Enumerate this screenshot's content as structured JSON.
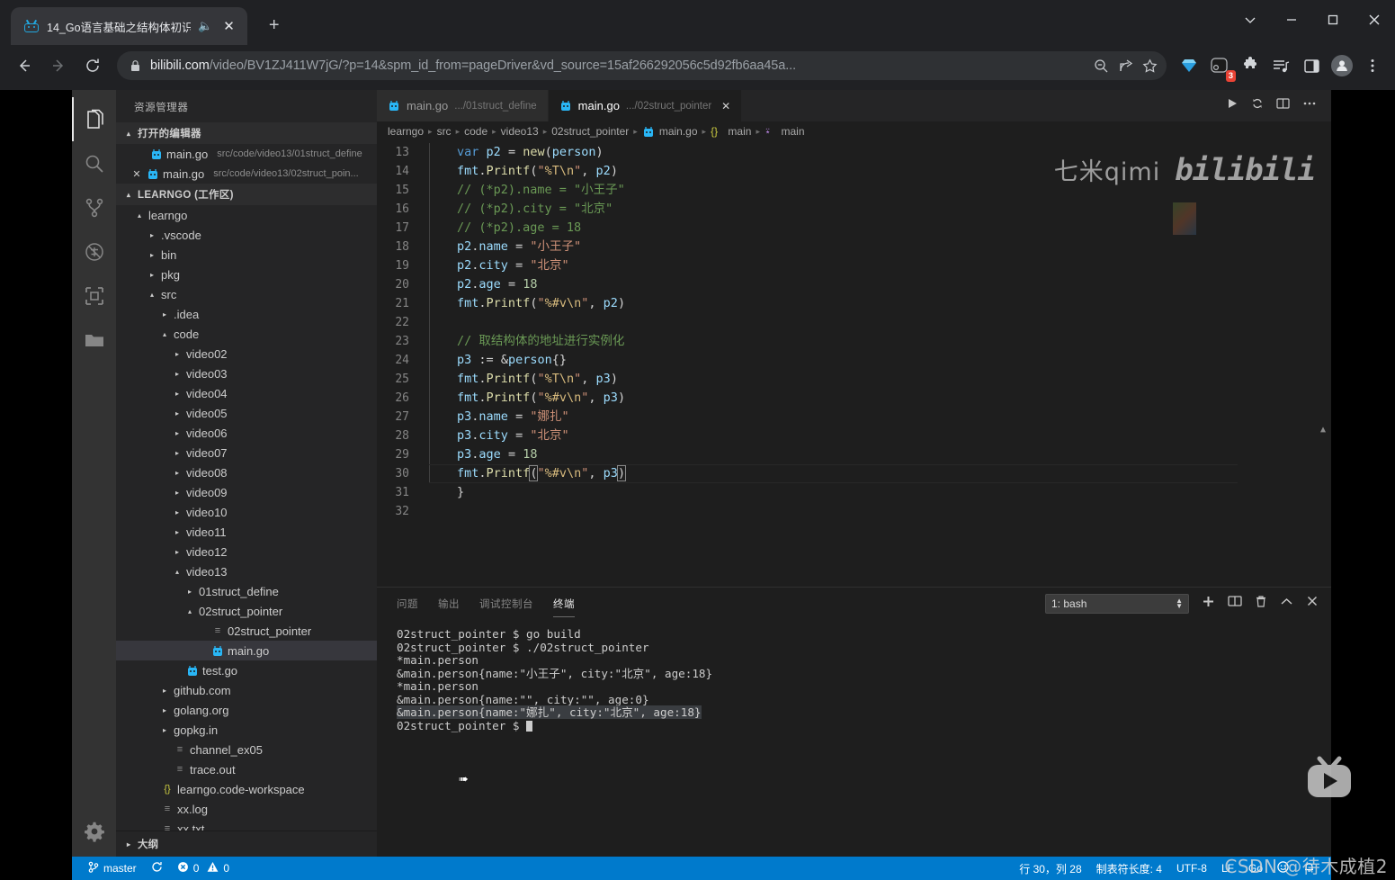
{
  "browser": {
    "tab": {
      "title": "14_Go语言基础之结构体初识",
      "favicon": "bilibili-tv-icon",
      "mute_icon": "speaker-mute-icon",
      "close_icon": "close-icon"
    },
    "newtab_label": "+",
    "window_controls": {
      "minimize_chevron": "chevron-down-icon",
      "minimize": "minimize-icon",
      "maximize": "maximize-icon",
      "close": "close-icon"
    },
    "nav": {
      "back": "back-arrow-icon",
      "forward": "forward-arrow-icon",
      "reload": "reload-icon"
    },
    "url": {
      "lock_icon": "lock-icon",
      "domain": "bilibili.com",
      "path": "/video/BV1ZJ411W7jG/?p=14&spm_id_from=pageDriver&vd_source=15af266292056c5d92fb6aa45a...",
      "zoom_icon": "zoom-out-icon",
      "share_icon": "share-icon",
      "bookmark_icon": "star-icon"
    },
    "toolbar_icons": [
      "diamond-extension-icon",
      "dark-reader-icon",
      "puzzle-extensions-icon",
      "playlist-icon",
      "side-panel-icon",
      "profile-avatar-icon",
      "chrome-menu-icon"
    ],
    "extension_badge": "3"
  },
  "vscode": {
    "activitybar": [
      {
        "name": "explorer-icon",
        "label": "资源管理器",
        "active": true
      },
      {
        "name": "search-icon",
        "label": "搜索",
        "active": false
      },
      {
        "name": "source-control-icon",
        "label": "源代码管理",
        "active": false
      },
      {
        "name": "run-debug-icon",
        "label": "运行和调试",
        "active": false
      },
      {
        "name": "extensions-icon",
        "label": "扩展",
        "active": false
      },
      {
        "name": "remote-folder-icon",
        "label": "远程资源管理器",
        "active": false
      },
      {
        "name": "settings-gear-icon",
        "label": "管理",
        "active": false
      }
    ],
    "sidebar": {
      "title": "资源管理器",
      "open_editors": {
        "label": "打开的编辑器",
        "twisty": "▴",
        "items": [
          {
            "name": "main.go",
            "path": "src/code/video13/01struct_define",
            "closable": false,
            "selected": false
          },
          {
            "name": "main.go",
            "path": "src/code/video13/02struct_poin...",
            "closable": true,
            "selected": false
          }
        ]
      },
      "workspace": {
        "label": "LEARNGO (工作区)",
        "twisty": "▴",
        "tree": [
          {
            "label": "learngo",
            "depth": 1,
            "type": "folder",
            "twisty": "▴"
          },
          {
            "label": ".vscode",
            "depth": 2,
            "type": "folder",
            "twisty": "▸"
          },
          {
            "label": "bin",
            "depth": 2,
            "type": "folder",
            "twisty": "▸"
          },
          {
            "label": "pkg",
            "depth": 2,
            "type": "folder",
            "twisty": "▸"
          },
          {
            "label": "src",
            "depth": 2,
            "type": "folder",
            "twisty": "▴"
          },
          {
            "label": ".idea",
            "depth": 3,
            "type": "folder",
            "twisty": "▸"
          },
          {
            "label": "code",
            "depth": 3,
            "type": "folder",
            "twisty": "▴"
          },
          {
            "label": "video02",
            "depth": 4,
            "type": "folder",
            "twisty": "▸"
          },
          {
            "label": "video03",
            "depth": 4,
            "type": "folder",
            "twisty": "▸"
          },
          {
            "label": "video04",
            "depth": 4,
            "type": "folder",
            "twisty": "▸"
          },
          {
            "label": "video05",
            "depth": 4,
            "type": "folder",
            "twisty": "▸"
          },
          {
            "label": "video06",
            "depth": 4,
            "type": "folder",
            "twisty": "▸"
          },
          {
            "label": "video07",
            "depth": 4,
            "type": "folder",
            "twisty": "▸"
          },
          {
            "label": "video08",
            "depth": 4,
            "type": "folder",
            "twisty": "▸"
          },
          {
            "label": "video09",
            "depth": 4,
            "type": "folder",
            "twisty": "▸"
          },
          {
            "label": "video10",
            "depth": 4,
            "type": "folder",
            "twisty": "▸"
          },
          {
            "label": "video11",
            "depth": 4,
            "type": "folder",
            "twisty": "▸"
          },
          {
            "label": "video12",
            "depth": 4,
            "type": "folder",
            "twisty": "▸"
          },
          {
            "label": "video13",
            "depth": 4,
            "type": "folder",
            "twisty": "▴"
          },
          {
            "label": "01struct_define",
            "depth": 5,
            "type": "folder",
            "twisty": "▸"
          },
          {
            "label": "02struct_pointer",
            "depth": 5,
            "type": "folder",
            "twisty": "▴"
          },
          {
            "label": "02struct_pointer",
            "depth": 6,
            "type": "binary"
          },
          {
            "label": "main.go",
            "depth": 6,
            "type": "go",
            "selected": true
          },
          {
            "label": "test.go",
            "depth": 4,
            "type": "go"
          },
          {
            "label": "github.com",
            "depth": 3,
            "type": "folder",
            "twisty": "▸"
          },
          {
            "label": "golang.org",
            "depth": 3,
            "type": "folder",
            "twisty": "▸"
          },
          {
            "label": "gopkg.in",
            "depth": 3,
            "type": "folder",
            "twisty": "▸"
          },
          {
            "label": "channel_ex05",
            "depth": 3,
            "type": "file"
          },
          {
            "label": "trace.out",
            "depth": 3,
            "type": "file"
          },
          {
            "label": "learngo.code-workspace",
            "depth": 2,
            "type": "json"
          },
          {
            "label": "xx.log",
            "depth": 2,
            "type": "file"
          },
          {
            "label": "xx.txt",
            "depth": 2,
            "type": "file"
          }
        ]
      },
      "outline_label": "大纲",
      "outline_twisty": "▸"
    },
    "editor_tabs": [
      {
        "name": "main.go",
        "path": ".../01struct_define",
        "active": false,
        "closable": false
      },
      {
        "name": "main.go",
        "path": ".../02struct_pointer",
        "active": true,
        "closable": true
      }
    ],
    "editor_actions": [
      "run-icon",
      "run-test-icon",
      "split-editor-icon",
      "more-actions-icon"
    ],
    "breadcrumb": [
      "learngo",
      "src",
      "code",
      "video13",
      "02struct_pointer",
      "main.go",
      "{} main",
      "main"
    ],
    "code_lines": [
      {
        "n": 13,
        "indent": true
      },
      {
        "n": 14,
        "indent": true
      },
      {
        "n": 15,
        "indent": true
      },
      {
        "n": 16,
        "indent": true
      },
      {
        "n": 17,
        "indent": true
      },
      {
        "n": 18,
        "indent": true
      },
      {
        "n": 19,
        "indent": true
      },
      {
        "n": 20,
        "indent": true
      },
      {
        "n": 21,
        "indent": true
      },
      {
        "n": 22,
        "indent": true
      },
      {
        "n": 23,
        "indent": true
      },
      {
        "n": 24,
        "indent": true
      },
      {
        "n": 25,
        "indent": true
      },
      {
        "n": 26,
        "indent": true
      },
      {
        "n": 27,
        "indent": true
      },
      {
        "n": 28,
        "indent": true
      },
      {
        "n": 29,
        "indent": true
      },
      {
        "n": 30,
        "indent": true
      },
      {
        "n": 31,
        "indent": false
      },
      {
        "n": 32,
        "indent": false
      }
    ],
    "code_text": [
      "    var p2 = new(person)",
      "    fmt.Printf(\"%T\\n\", p2)",
      "    // (*p2).name = \"小王子\"",
      "    // (*p2).city = \"北京\"",
      "    // (*p2).age = 18",
      "    p2.name = \"小王子\"",
      "    p2.city = \"北京\"",
      "    p2.age = 18",
      "    fmt.Printf(\"%#v\\n\", p2)",
      "",
      "    // 取结构体的地址进行实例化",
      "    p3 := &person{}",
      "    fmt.Printf(\"%T\\n\", p3)",
      "    fmt.Printf(\"%#v\\n\", p3)",
      "    p3.name = \"娜扎\"",
      "    p3.city = \"北京\"",
      "    p3.age = 18",
      "    fmt.Printf(\"%#v\\n\", p3)",
      "}",
      ""
    ],
    "watermark": {
      "channel": "七米qimi",
      "site": "bilibili",
      "csdn": "CSDN @待木成植2"
    },
    "panel": {
      "tabs": [
        {
          "label": "问题",
          "active": false
        },
        {
          "label": "输出",
          "active": false
        },
        {
          "label": "调试控制台",
          "active": false
        },
        {
          "label": "终端",
          "active": true
        }
      ],
      "terminal_select": "1: bash",
      "actions": [
        "new-terminal-icon",
        "split-terminal-icon",
        "kill-terminal-icon",
        "maximize-panel-icon",
        "close-panel-icon"
      ],
      "terminal_lines": [
        {
          "text": "02struct_pointer $ go build",
          "highlight": false
        },
        {
          "text": "02struct_pointer $ ./02struct_pointer",
          "highlight": false
        },
        {
          "text": "*main.person",
          "highlight": false
        },
        {
          "text": "&main.person{name:\"小王子\", city:\"北京\", age:18}",
          "highlight": false
        },
        {
          "text": "*main.person",
          "highlight": false
        },
        {
          "text": "&main.person{name:\"\", city:\"\", age:0}",
          "highlight": false
        },
        {
          "text": "&main.person{name:\"娜扎\", city:\"北京\", age:18}",
          "highlight": true
        }
      ],
      "prompt": "02struct_pointer $ "
    },
    "statusbar": {
      "branch_icon": "source-control-branch-icon",
      "branch": "master",
      "sync_icon": "sync-icon",
      "error_icon": "error-icon",
      "errors": "0",
      "warning_icon": "warning-icon",
      "warnings": "0",
      "position": "行 30，列 28",
      "tabsize": "制表符长度: 4",
      "encoding": "UTF-8",
      "eol": "LF",
      "language": "Go",
      "feedback_icon": "smiley-icon",
      "bell_icon": "bell-icon"
    }
  }
}
